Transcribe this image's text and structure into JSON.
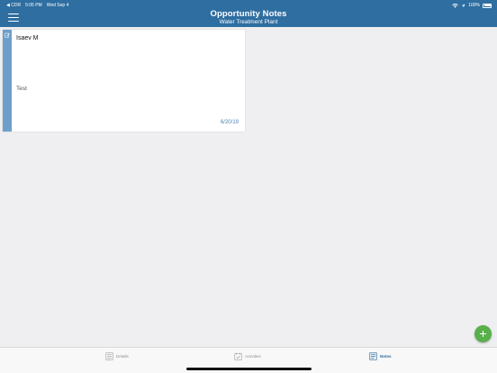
{
  "status_bar": {
    "back_app": "◀ CDR",
    "time": "5:05 PM",
    "date": "Wed Sep 4",
    "battery_percent": "100%"
  },
  "header": {
    "title": "Opportunity Notes",
    "subtitle": "Water Treatment Plant"
  },
  "notes": [
    {
      "author": "Isaev M",
      "body": "Test",
      "date": "6/20/19"
    }
  ],
  "tabs": [
    {
      "label": "Details",
      "icon": "details-icon",
      "active": false
    },
    {
      "label": "Activities",
      "icon": "activities-icon",
      "active": false
    },
    {
      "label": "Notes",
      "icon": "notes-icon",
      "active": true
    }
  ],
  "colors": {
    "header": "#2e6ea1",
    "card_strip": "#6e9fcb",
    "fab": "#58b04a",
    "accent": "#2e6ea1",
    "background": "#efeff1"
  }
}
